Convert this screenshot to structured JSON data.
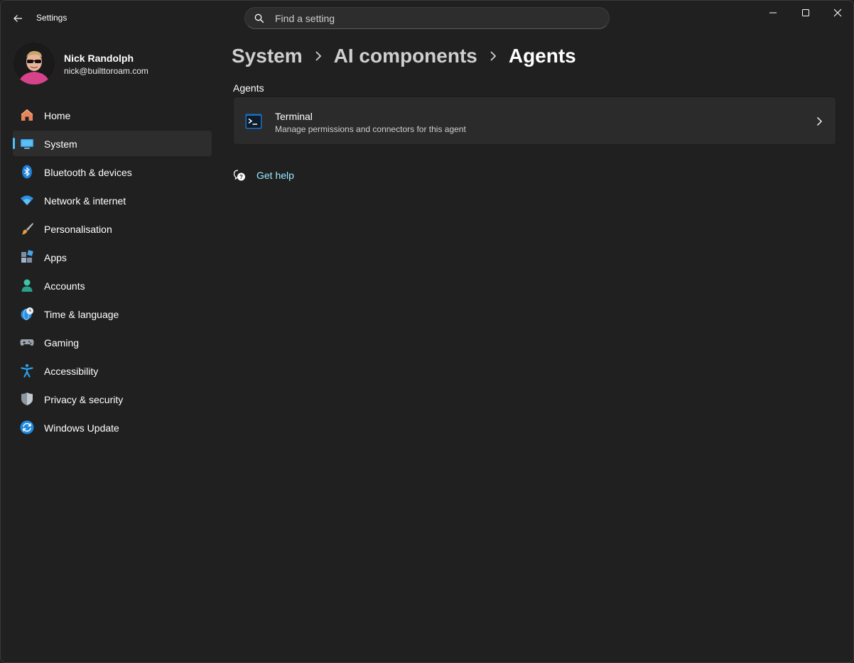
{
  "window": {
    "title": "Settings",
    "controls": {
      "minimize": "minimize-icon",
      "maximize": "maximize-icon",
      "close": "close-icon"
    }
  },
  "search": {
    "placeholder": "Find a setting",
    "value": ""
  },
  "profile": {
    "name": "Nick Randolph",
    "email": "nick@builttoroam.com"
  },
  "sidebar": {
    "items": [
      {
        "label": "Home",
        "icon": "home-icon",
        "selected": false
      },
      {
        "label": "System",
        "icon": "system-icon",
        "selected": true
      },
      {
        "label": "Bluetooth & devices",
        "icon": "bluetooth-icon",
        "selected": false
      },
      {
        "label": "Network & internet",
        "icon": "wifi-icon",
        "selected": false
      },
      {
        "label": "Personalisation",
        "icon": "brush-icon",
        "selected": false
      },
      {
        "label": "Apps",
        "icon": "apps-icon",
        "selected": false
      },
      {
        "label": "Accounts",
        "icon": "person-icon",
        "selected": false
      },
      {
        "label": "Time & language",
        "icon": "globe-clock-icon",
        "selected": false
      },
      {
        "label": "Gaming",
        "icon": "gamepad-icon",
        "selected": false
      },
      {
        "label": "Accessibility",
        "icon": "accessibility-icon",
        "selected": false
      },
      {
        "label": "Privacy & security",
        "icon": "shield-icon",
        "selected": false
      },
      {
        "label": "Windows Update",
        "icon": "update-icon",
        "selected": false
      }
    ]
  },
  "breadcrumb": [
    "System",
    "AI components",
    "Agents"
  ],
  "main": {
    "section_label": "Agents",
    "card": {
      "title": "Terminal",
      "subtitle": "Manage permissions and connectors for this agent",
      "icon": "terminal-icon"
    },
    "help_link": "Get help"
  },
  "colors": {
    "background": "#202020",
    "card": "#2b2b2b",
    "accent": "#4cc2ff",
    "link": "#99ebff",
    "selected_nav": "#2d2d2d"
  }
}
